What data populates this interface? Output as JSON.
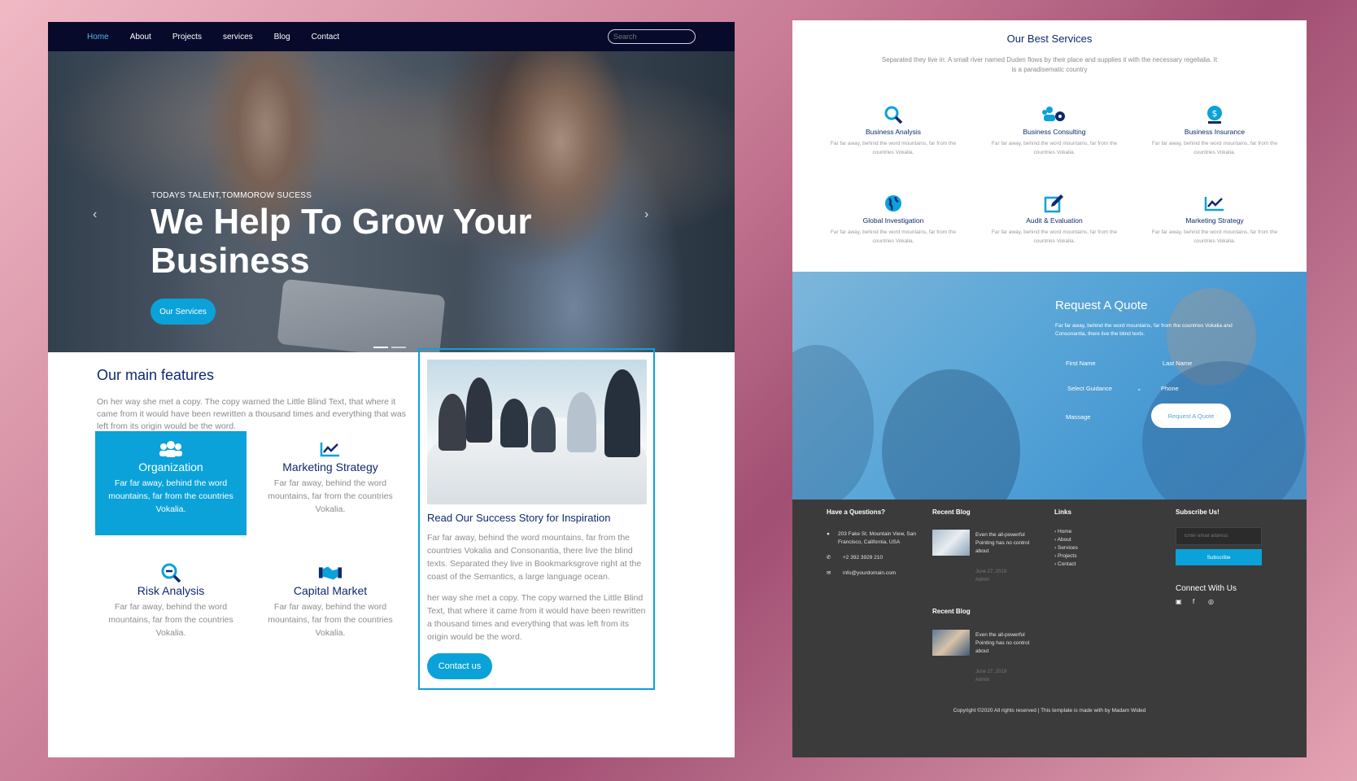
{
  "nav": {
    "items": [
      "Home",
      "About",
      "Projects",
      "services",
      "Blog",
      "Contact"
    ],
    "search_placeholder": "Search"
  },
  "hero": {
    "kicker": "TODAYS TALENT,TOMMOROW SUCESS",
    "title": "We Help To Grow Your Business",
    "button": "Our Services",
    "prev_icon": "chevron-left-icon",
    "next_icon": "chevron-right-icon"
  },
  "features": {
    "title": "Our main features",
    "text": "On her way she met a copy. The copy warned the Little Blind Text, that where it came from it would have been rewritten a thousand times and everything that was left from its origin would be the word.",
    "cards": [
      {
        "title": "Organization",
        "desc": "Far far away, behind the word mountains, far from the countries Vokalia.",
        "icon": "users-icon"
      },
      {
        "title": "Marketing Strategy",
        "desc": "Far far away, behind the word mountains, far from the countries Vokalia.",
        "icon": "chart-line-icon"
      },
      {
        "title": "Risk Analysis",
        "desc": "Far far away, behind the word mountains, far from the countries Vokalia.",
        "icon": "search-minus-icon"
      },
      {
        "title": "Capital Market",
        "desc": "Far far away, behind the word mountains, far from the countries Vokalia.",
        "icon": "handshake-icon"
      }
    ]
  },
  "story": {
    "title": "Read Our Success Story for Inspiration",
    "p1": "Far far away, behind the word mountains, far from the countries Vokalia and Consonantia, there live the blind texts. Separated they live in Bookmarksgrove right at the coast of the Semantics, a large language ocean.",
    "p2": "her way she met a copy. The copy warned the Little Blind Text, that where it came from it would have been rewritten a thousand times and everything that was left from its origin would be the word.",
    "button": "Contact us"
  },
  "services": {
    "title": "Our Best Services",
    "subtitle": "Separated they live in. A small river named Duden flows by their place and supplies it with the necessary regelialia. It is a paradisematic country",
    "items": [
      {
        "title": "Business Analysis",
        "desc": "Far far away, behind the word mountains, far from the countries Vokalia.",
        "icon": "search-icon"
      },
      {
        "title": "Business Consulting",
        "desc": "Far far away, behind the word mountains, far from the countries Vokalia.",
        "icon": "users-cog-icon"
      },
      {
        "title": "Business Insurance",
        "desc": "Far far away, behind the word mountains, far from the countries Vokalia.",
        "icon": "dollar-shield-icon"
      },
      {
        "title": "Global Investigation",
        "desc": "Far far away, behind the word mountains, far from the countries Vokalia.",
        "icon": "globe-icon"
      },
      {
        "title": "Audit & Evaluation",
        "desc": "Far far away, behind the word mountains, far from the countries Vokalia.",
        "icon": "edit-icon"
      },
      {
        "title": "Marketing Strategy",
        "desc": "Far far away, behind the word mountains, far from the countries Vokalia.",
        "icon": "chart-line-icon"
      }
    ]
  },
  "quote": {
    "title": "Request A Quote",
    "desc": "Far far away, behind the word mountains, far from the countries Vokalia and Consonantia, there live the blind texts.",
    "first_name": "First Name",
    "last_name": "Last Name",
    "select": "Select Guidance",
    "phone": "Phone",
    "message": "Massage",
    "button": "Request A Quote"
  },
  "footer": {
    "questions_title": "Have a Questions?",
    "address": "203 Fake St. Mountain View, San Francisco, California, USA",
    "phone": "+2 392 3929 210",
    "email": "info@yourdomain.com",
    "blog_title": "Recent Blog",
    "blog_title2": "Recent Blog",
    "blog1_text": "Even the all-powerful Pointing has no control about",
    "blog1_date": "June 27, 2019",
    "blog1_author": "Admin",
    "blog2_text": "Even the all-powerful Pointing has no control about",
    "blog2_date": "June 27, 2019",
    "blog2_author": "Admin",
    "links_title": "Links",
    "links": [
      "Home",
      "About",
      "Services",
      "Projects",
      "Contact"
    ],
    "subscribe_title": "Subscribe Us!",
    "email_placeholder": "Enter email address",
    "subscribe_button": "Subscribe",
    "connect_title": "Connect With Us",
    "copyright": "Copyright ©2020 All rights reserved | This template is made with by Madam Wided"
  },
  "colors": {
    "accent": "#0aa2d9",
    "navy": "#0d2a6e",
    "nav_bg": "#070a2a",
    "footer_bg": "#3b3b3b"
  }
}
